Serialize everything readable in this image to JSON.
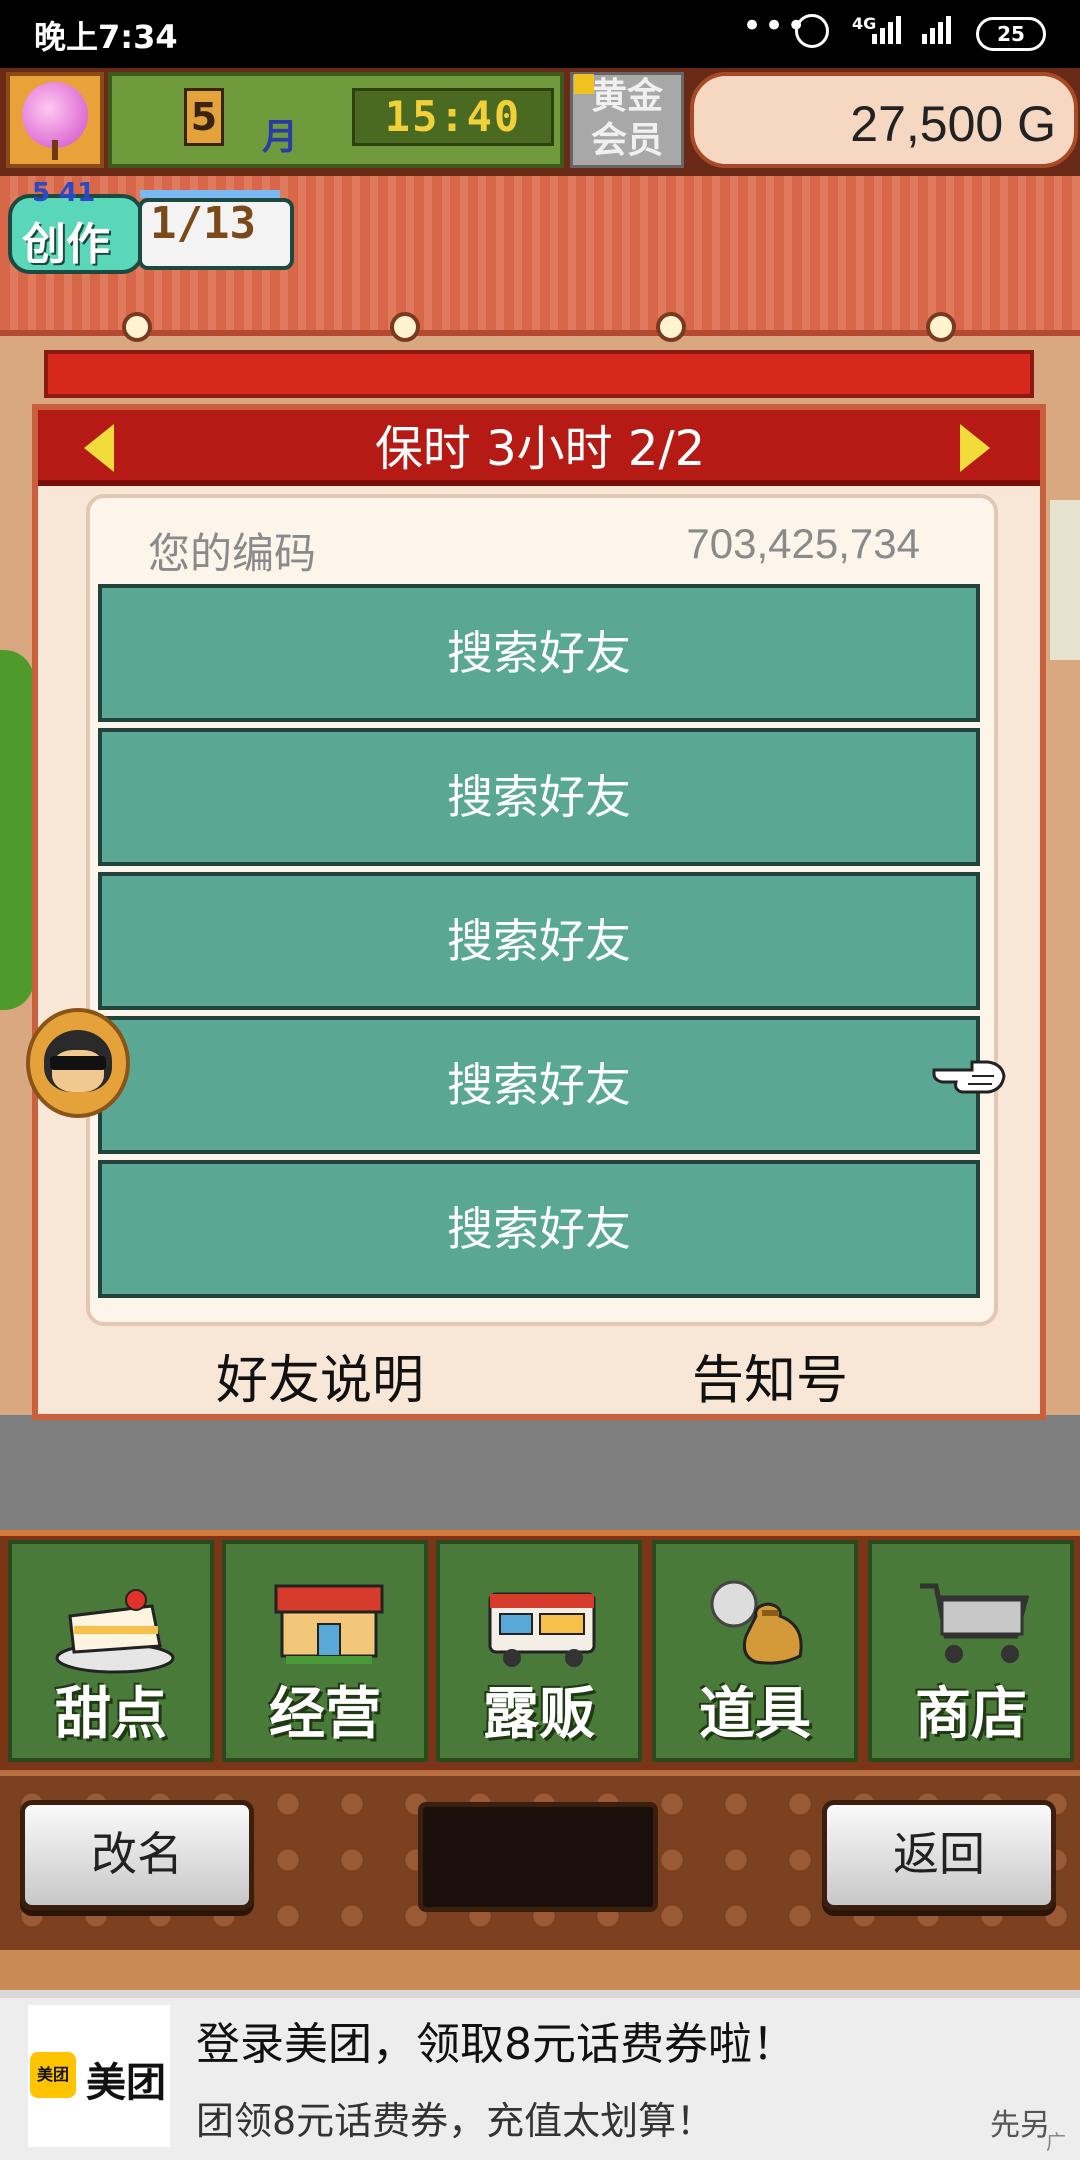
{
  "status_bar": {
    "time": "晚上7:34",
    "network": "4G",
    "battery": "25"
  },
  "hud": {
    "month": "5",
    "month_unit": "月",
    "clock": "15:40",
    "membership": [
      "黄金",
      "会员"
    ],
    "money": "27,500 G"
  },
  "creation": {
    "label": "创作",
    "level": "5 41",
    "progress": "1/13"
  },
  "dialog": {
    "title": "保时  3小时 2/2",
    "code_label": "您的编码",
    "code_value": "703,425,734",
    "friend_slots": [
      "搜索好友",
      "搜索好友",
      "搜索好友",
      "搜索好友",
      "搜索好友"
    ],
    "help_link": "好友说明",
    "notice_link": "告知号"
  },
  "tabs": [
    {
      "label": "甜点",
      "icon": "cake-icon"
    },
    {
      "label": "经营",
      "icon": "shop-icon"
    },
    {
      "label": "露贩",
      "icon": "food-truck-icon"
    },
    {
      "label": "道具",
      "icon": "item-bag-icon"
    },
    {
      "label": "商店",
      "icon": "shopping-cart-icon"
    }
  ],
  "controls": {
    "rename": "改名",
    "back": "返回"
  },
  "ad": {
    "brand_badge": "美团",
    "brand_text": "美团",
    "title": "登录美团，领取8元话费券啦！",
    "subtitle": "团领8元话费券，充值太划算！",
    "corner": "先另",
    "tag": "广告"
  },
  "colors": {
    "dialog_header": "#b61a14",
    "friend_button": "#5aa894",
    "tab_bg": "#4a7a3a",
    "accent_yellow": "#f2dc3c"
  }
}
